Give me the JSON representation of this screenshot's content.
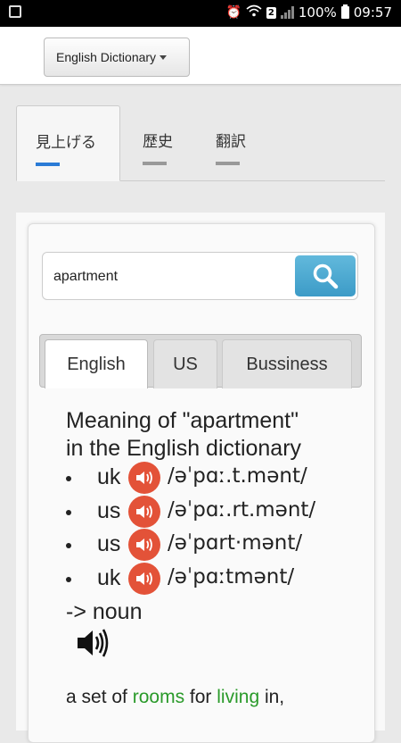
{
  "status_bar": {
    "badge": "2",
    "battery": "100%",
    "time": "09:57"
  },
  "header": {
    "dictionary_select": "English Dictionary"
  },
  "top_tabs": [
    {
      "label": "見上げる",
      "active": true
    },
    {
      "label": "歴史",
      "active": false
    },
    {
      "label": "翻訳",
      "active": false
    }
  ],
  "search": {
    "value": "apartment"
  },
  "sub_tabs": [
    {
      "label": "English",
      "active": true
    },
    {
      "label": "US",
      "active": false
    },
    {
      "label": "Bussiness",
      "active": false
    }
  ],
  "entry": {
    "heading_line1": "Meaning of \"apartment\"",
    "heading_line2": "in the English dictionary",
    "pronunciations": [
      {
        "region": "uk",
        "ipa": "/əˈpɑː.t.mənt/"
      },
      {
        "region": "us",
        "ipa": "/əˈpɑː.rt.mənt/"
      },
      {
        "region": "us",
        "ipa": "/əˈpɑrt·mənt/"
      },
      {
        "region": "uk",
        "ipa": "/əˈpɑːtmənt/"
      }
    ],
    "part_of_speech": "-> noun",
    "definition": {
      "t1": "a set of ",
      "link1": "rooms",
      "t2": " for ",
      "link2": "living",
      "t3": " in,"
    }
  },
  "colors": {
    "accent_tab": "#2a7bd6",
    "search_button": "#3c9bc7",
    "speaker_button": "#e35238",
    "link": "#2a9a2a"
  }
}
